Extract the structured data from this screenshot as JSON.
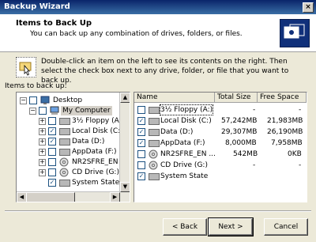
{
  "window": {
    "title": "Backup Wizard"
  },
  "header": {
    "title": "Items to Back Up",
    "subtitle": "You can back up any combination of drives, folders, or files.",
    "icon": "backup-wizard-icon"
  },
  "instructions": "Double-click an item on the left to see its contents on the right. Then select the check box next to any drive, folder, or file that you want to back up.",
  "tree": {
    "label": "Items to back up:",
    "items": [
      {
        "label": "Desktop",
        "level": 0,
        "expanded": true,
        "checked": false,
        "icon": "desktop-icon"
      },
      {
        "label": "My Computer",
        "level": 1,
        "expanded": true,
        "checked": false,
        "selected": true,
        "icon": "my-computer-icon"
      },
      {
        "label": "3½ Floppy (A:)",
        "level": 2,
        "expanded": false,
        "checked": false,
        "icon": "floppy-drive-icon"
      },
      {
        "label": "Local Disk (C:)",
        "level": 2,
        "expanded": false,
        "checked": true,
        "icon": "hard-drive-icon"
      },
      {
        "label": "Data (D:)",
        "level": 2,
        "expanded": false,
        "checked": true,
        "icon": "hard-drive-icon"
      },
      {
        "label": "AppData (F:)",
        "level": 2,
        "expanded": false,
        "checked": false,
        "icon": "hard-drive-icon"
      },
      {
        "label": "NR2SFRE_EN",
        "level": 2,
        "expanded": false,
        "checked": false,
        "icon": "cd-drive-icon"
      },
      {
        "label": "CD Drive (G:)",
        "level": 2,
        "expanded": false,
        "checked": false,
        "icon": "cd-drive-icon"
      },
      {
        "label": "System State",
        "level": 2,
        "expanded": false,
        "checked": true,
        "icon": "system-state-icon"
      }
    ]
  },
  "list": {
    "columns": [
      "Name",
      "Total Size",
      "Free Space"
    ],
    "rows": [
      {
        "name": "3½ Floppy (A:)",
        "total": "-",
        "free": "-",
        "checked": false
      },
      {
        "name": "Local Disk (C:)",
        "total": "57,242MB",
        "free": "21,983MB",
        "checked": true
      },
      {
        "name": "Data (D:)",
        "total": "29,307MB",
        "free": "26,190MB",
        "checked": true
      },
      {
        "name": "AppData (F:)",
        "total": "8,000MB",
        "free": "7,958MB",
        "checked": true
      },
      {
        "name": "NR2SFRE_EN ...",
        "total": "542MB",
        "free": "0KB",
        "checked": false
      },
      {
        "name": "CD Drive (G:)",
        "total": "-",
        "free": "-",
        "checked": false
      },
      {
        "name": "System State",
        "total": "",
        "free": "",
        "checked": true
      }
    ]
  },
  "buttons": {
    "back": "< Back",
    "next": "Next >",
    "cancel": "Cancel"
  }
}
